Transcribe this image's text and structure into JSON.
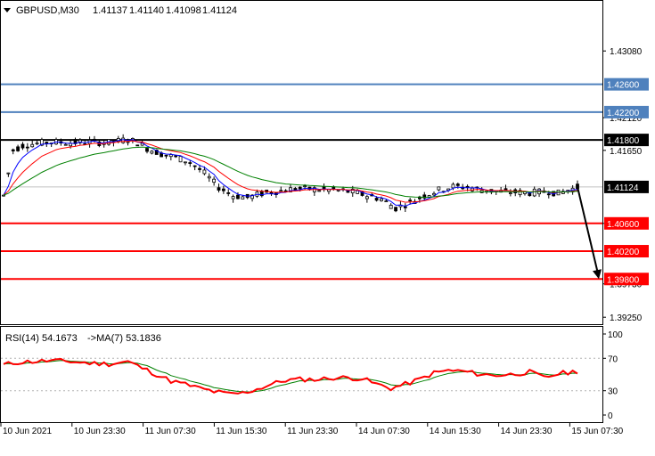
{
  "header": {
    "symbol_label": "GBPUSD,M30",
    "ohlc": [
      "1.41137",
      "1.41140",
      "1.41098",
      "1.41124"
    ]
  },
  "colors": {
    "frame": "#000000",
    "candle": "#000000",
    "ma_fast": "#0000ff",
    "ma_mid": "#ff0000",
    "ma_slow": "#008000",
    "level_blue": "#4f81bd",
    "level_red": "#ff0000",
    "level_black": "#000000",
    "rsi_line": "#ff0000",
    "rsi_ma": "#008000",
    "price_tag_bg": "#000000",
    "price_tag_text": "#ffffff"
  },
  "chart_data": {
    "type": "candlestick",
    "symbol": "GBPUSD",
    "timeframe": "M30",
    "price_axis": {
      "ylim": [
        1.3915,
        1.438
      ],
      "ticks": [
        "1.43080",
        "1.42120",
        "1.41650",
        "1.40600",
        "1.39730",
        "1.39250"
      ]
    },
    "time_axis": {
      "labels": [
        "10 Jun 2021",
        "10 Jun 23:30",
        "11 Jun 07:30",
        "11 Jun 15:30",
        "11 Jun 23:30",
        "14 Jun 07:30",
        "14 Jun 15:30",
        "14 Jun 23:30",
        "15 Jun 07:30"
      ]
    },
    "current_price": "1.41124",
    "levels": [
      {
        "price": 1.426,
        "label": "1.42600",
        "style": "blue"
      },
      {
        "price": 1.422,
        "label": "1.42200",
        "style": "blue"
      },
      {
        "price": 1.418,
        "label": "1.41800",
        "style": "black"
      },
      {
        "price": 1.406,
        "label": "1.40600",
        "style": "red"
      },
      {
        "price": 1.402,
        "label": "1.40200",
        "style": "red"
      },
      {
        "price": 1.398,
        "label": "1.39800",
        "style": "red"
      }
    ],
    "forecast_arrow": {
      "from_price": 1.41124,
      "to_price": 1.398
    },
    "price_path": [
      [
        0,
        1.41
      ],
      [
        2,
        1.4165
      ],
      [
        4,
        1.4172
      ],
      [
        7,
        1.4175
      ],
      [
        10,
        1.4177
      ],
      [
        14,
        1.4176
      ],
      [
        18,
        1.4177
      ],
      [
        22,
        1.4176
      ],
      [
        26,
        1.4181
      ],
      [
        28,
        1.4176
      ],
      [
        30,
        1.4168
      ],
      [
        33,
        1.416
      ],
      [
        36,
        1.4155
      ],
      [
        39,
        1.4148
      ],
      [
        42,
        1.4132
      ],
      [
        45,
        1.4112
      ],
      [
        48,
        1.41
      ],
      [
        51,
        1.4097
      ],
      [
        54,
        1.4103
      ],
      [
        57,
        1.4106
      ],
      [
        61,
        1.411
      ],
      [
        65,
        1.4109
      ],
      [
        69,
        1.4108
      ],
      [
        73,
        1.4105
      ],
      [
        76,
        1.41
      ],
      [
        79,
        1.4095
      ],
      [
        82,
        1.4082
      ],
      [
        85,
        1.409
      ],
      [
        88,
        1.41
      ],
      [
        91,
        1.4108
      ],
      [
        94,
        1.4113
      ],
      [
        97,
        1.4112
      ],
      [
        100,
        1.4108
      ],
      [
        103,
        1.4106
      ],
      [
        106,
        1.4105
      ],
      [
        110,
        1.4104
      ],
      [
        114,
        1.4106
      ],
      [
        116,
        1.4103
      ],
      [
        118,
        1.4108
      ],
      [
        120,
        1.4112
      ]
    ],
    "moving_averages": [
      {
        "color": "blue",
        "period": "fast"
      },
      {
        "color": "red",
        "period": "mid"
      },
      {
        "color": "green",
        "period": "slow"
      }
    ],
    "rsi": {
      "label": "RSI(14) 54.1673",
      "ma_label": "->MA(7) 53.1836",
      "value": 54.1673,
      "ma_value": 53.1836,
      "ylim": [
        0,
        100
      ],
      "ticks": [
        "100",
        "70",
        "30",
        "0"
      ],
      "levels": [
        70,
        30
      ],
      "rsi_path": [
        [
          0,
          62
        ],
        [
          3,
          65
        ],
        [
          6,
          66
        ],
        [
          10,
          67
        ],
        [
          14,
          66
        ],
        [
          18,
          64
        ],
        [
          22,
          63
        ],
        [
          26,
          66
        ],
        [
          29,
          58
        ],
        [
          32,
          50
        ],
        [
          35,
          42
        ],
        [
          38,
          38
        ],
        [
          41,
          33
        ],
        [
          44,
          29
        ],
        [
          47,
          26
        ],
        [
          50,
          27
        ],
        [
          53,
          32
        ],
        [
          56,
          38
        ],
        [
          59,
          43
        ],
        [
          62,
          44
        ],
        [
          66,
          44
        ],
        [
          69,
          46
        ],
        [
          72,
          46
        ],
        [
          75,
          45
        ],
        [
          78,
          38
        ],
        [
          81,
          33
        ],
        [
          84,
          38
        ],
        [
          87,
          44
        ],
        [
          90,
          52
        ],
        [
          93,
          55
        ],
        [
          96,
          54
        ],
        [
          99,
          51
        ],
        [
          102,
          49
        ],
        [
          106,
          50
        ],
        [
          110,
          53
        ],
        [
          113,
          46
        ],
        [
          116,
          51
        ],
        [
          120,
          54
        ]
      ]
    }
  }
}
